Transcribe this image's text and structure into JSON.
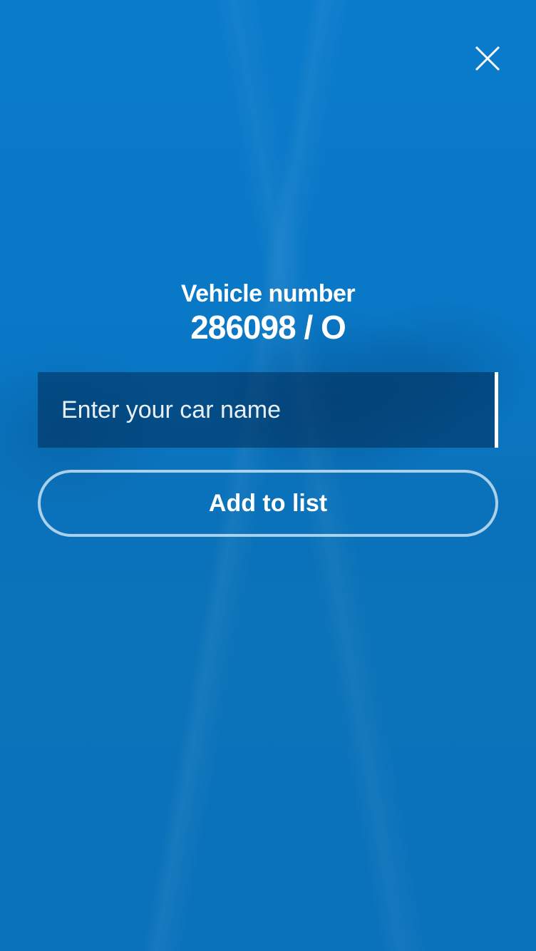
{
  "header": {
    "close_icon": "close-icon"
  },
  "vehicle": {
    "label": "Vehicle number",
    "number": "286098 / O"
  },
  "form": {
    "car_name_value": "",
    "car_name_placeholder": "Enter your car name",
    "add_button_label": "Add to list"
  },
  "colors": {
    "background": "#0a78c6",
    "input_background": "#14466e",
    "text": "#ffffff",
    "button_border": "#c8e1f2"
  }
}
